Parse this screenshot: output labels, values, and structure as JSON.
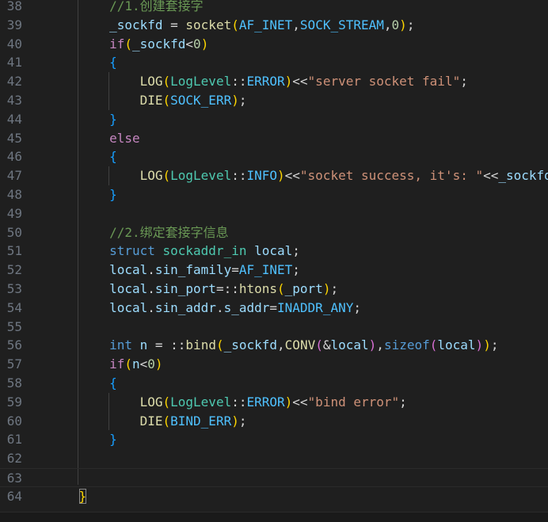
{
  "editor": {
    "lines": [
      {
        "n": "38",
        "tokens": [
          {
            "t": "        ",
            "c": "plain"
          },
          {
            "t": "//1.创建套接字",
            "c": "cmt"
          }
        ]
      },
      {
        "n": "39",
        "tokens": [
          {
            "t": "        ",
            "c": "plain"
          },
          {
            "t": "_sockfd",
            "c": "var"
          },
          {
            "t": " = ",
            "c": "op"
          },
          {
            "t": "socket",
            "c": "func"
          },
          {
            "t": "(",
            "c": "b1"
          },
          {
            "t": "AF_INET",
            "c": "const"
          },
          {
            "t": ",",
            "c": "op"
          },
          {
            "t": "SOCK_STREAM",
            "c": "const"
          },
          {
            "t": ",",
            "c": "op"
          },
          {
            "t": "0",
            "c": "num"
          },
          {
            "t": ")",
            "c": "b1"
          },
          {
            "t": ";",
            "c": "op"
          }
        ]
      },
      {
        "n": "40",
        "tokens": [
          {
            "t": "        ",
            "c": "plain"
          },
          {
            "t": "if",
            "c": "kw"
          },
          {
            "t": "(",
            "c": "b1"
          },
          {
            "t": "_sockfd",
            "c": "var"
          },
          {
            "t": "<",
            "c": "op"
          },
          {
            "t": "0",
            "c": "num"
          },
          {
            "t": ")",
            "c": "b1"
          }
        ]
      },
      {
        "n": "41",
        "tokens": [
          {
            "t": "        ",
            "c": "plain"
          },
          {
            "t": "{",
            "c": "b3"
          }
        ]
      },
      {
        "n": "42",
        "tokens": [
          {
            "t": "            ",
            "c": "plain"
          },
          {
            "t": "LOG",
            "c": "macro"
          },
          {
            "t": "(",
            "c": "b1"
          },
          {
            "t": "LogLevel",
            "c": "cls"
          },
          {
            "t": "::",
            "c": "op"
          },
          {
            "t": "ERROR",
            "c": "const"
          },
          {
            "t": ")",
            "c": "b1"
          },
          {
            "t": "<<",
            "c": "op"
          },
          {
            "t": "\"server socket fail\"",
            "c": "str"
          },
          {
            "t": ";",
            "c": "op"
          }
        ]
      },
      {
        "n": "43",
        "tokens": [
          {
            "t": "            ",
            "c": "plain"
          },
          {
            "t": "DIE",
            "c": "macro"
          },
          {
            "t": "(",
            "c": "b1"
          },
          {
            "t": "SOCK_ERR",
            "c": "const"
          },
          {
            "t": ")",
            "c": "b1"
          },
          {
            "t": ";",
            "c": "op"
          }
        ]
      },
      {
        "n": "44",
        "tokens": [
          {
            "t": "        ",
            "c": "plain"
          },
          {
            "t": "}",
            "c": "b3"
          }
        ]
      },
      {
        "n": "45",
        "tokens": [
          {
            "t": "        ",
            "c": "plain"
          },
          {
            "t": "else",
            "c": "kw"
          }
        ]
      },
      {
        "n": "46",
        "tokens": [
          {
            "t": "        ",
            "c": "plain"
          },
          {
            "t": "{",
            "c": "b3"
          }
        ]
      },
      {
        "n": "47",
        "tokens": [
          {
            "t": "            ",
            "c": "plain"
          },
          {
            "t": "LOG",
            "c": "macro"
          },
          {
            "t": "(",
            "c": "b1"
          },
          {
            "t": "LogLevel",
            "c": "cls"
          },
          {
            "t": "::",
            "c": "op"
          },
          {
            "t": "INFO",
            "c": "const"
          },
          {
            "t": ")",
            "c": "b1"
          },
          {
            "t": "<<",
            "c": "op"
          },
          {
            "t": "\"socket success, it's: \"",
            "c": "str"
          },
          {
            "t": "<<",
            "c": "op"
          },
          {
            "t": "_sockfd",
            "c": "var"
          }
        ]
      },
      {
        "n": "48",
        "tokens": [
          {
            "t": "        ",
            "c": "plain"
          },
          {
            "t": "}",
            "c": "b3"
          }
        ]
      },
      {
        "n": "49",
        "tokens": []
      },
      {
        "n": "50",
        "tokens": [
          {
            "t": "        ",
            "c": "plain"
          },
          {
            "t": "//2.绑定套接字信息",
            "c": "cmt"
          }
        ]
      },
      {
        "n": "51",
        "tokens": [
          {
            "t": "        ",
            "c": "plain"
          },
          {
            "t": "struct",
            "c": "type"
          },
          {
            "t": " ",
            "c": "plain"
          },
          {
            "t": "sockaddr_in",
            "c": "cls"
          },
          {
            "t": " ",
            "c": "plain"
          },
          {
            "t": "local",
            "c": "var"
          },
          {
            "t": ";",
            "c": "op"
          }
        ]
      },
      {
        "n": "52",
        "tokens": [
          {
            "t": "        ",
            "c": "plain"
          },
          {
            "t": "local",
            "c": "var"
          },
          {
            "t": ".",
            "c": "op"
          },
          {
            "t": "sin_family",
            "c": "var"
          },
          {
            "t": "=",
            "c": "op"
          },
          {
            "t": "AF_INET",
            "c": "const"
          },
          {
            "t": ";",
            "c": "op"
          }
        ]
      },
      {
        "n": "53",
        "tokens": [
          {
            "t": "        ",
            "c": "plain"
          },
          {
            "t": "local",
            "c": "var"
          },
          {
            "t": ".",
            "c": "op"
          },
          {
            "t": "sin_port",
            "c": "var"
          },
          {
            "t": "=::",
            "c": "op"
          },
          {
            "t": "htons",
            "c": "func"
          },
          {
            "t": "(",
            "c": "b1"
          },
          {
            "t": "_port",
            "c": "var"
          },
          {
            "t": ")",
            "c": "b1"
          },
          {
            "t": ";",
            "c": "op"
          }
        ]
      },
      {
        "n": "54",
        "tokens": [
          {
            "t": "        ",
            "c": "plain"
          },
          {
            "t": "local",
            "c": "var"
          },
          {
            "t": ".",
            "c": "op"
          },
          {
            "t": "sin_addr",
            "c": "var"
          },
          {
            "t": ".",
            "c": "op"
          },
          {
            "t": "s_addr",
            "c": "var"
          },
          {
            "t": "=",
            "c": "op"
          },
          {
            "t": "INADDR_ANY",
            "c": "const"
          },
          {
            "t": ";",
            "c": "op"
          }
        ]
      },
      {
        "n": "55",
        "tokens": []
      },
      {
        "n": "56",
        "tokens": [
          {
            "t": "        ",
            "c": "plain"
          },
          {
            "t": "int",
            "c": "type"
          },
          {
            "t": " ",
            "c": "plain"
          },
          {
            "t": "n",
            "c": "var"
          },
          {
            "t": " = ::",
            "c": "op"
          },
          {
            "t": "bind",
            "c": "func"
          },
          {
            "t": "(",
            "c": "b1"
          },
          {
            "t": "_sockfd",
            "c": "var"
          },
          {
            "t": ",",
            "c": "op"
          },
          {
            "t": "CONV",
            "c": "macro"
          },
          {
            "t": "(",
            "c": "b2"
          },
          {
            "t": "&",
            "c": "op"
          },
          {
            "t": "local",
            "c": "var"
          },
          {
            "t": ")",
            "c": "b2"
          },
          {
            "t": ",",
            "c": "op"
          },
          {
            "t": "sizeof",
            "c": "type"
          },
          {
            "t": "(",
            "c": "b2"
          },
          {
            "t": "local",
            "c": "var"
          },
          {
            "t": ")",
            "c": "b2"
          },
          {
            "t": ")",
            "c": "b1"
          },
          {
            "t": ";",
            "c": "op"
          }
        ]
      },
      {
        "n": "57",
        "tokens": [
          {
            "t": "        ",
            "c": "plain"
          },
          {
            "t": "if",
            "c": "kw"
          },
          {
            "t": "(",
            "c": "b1"
          },
          {
            "t": "n",
            "c": "var"
          },
          {
            "t": "<",
            "c": "op"
          },
          {
            "t": "0",
            "c": "num"
          },
          {
            "t": ")",
            "c": "b1"
          }
        ]
      },
      {
        "n": "58",
        "tokens": [
          {
            "t": "        ",
            "c": "plain"
          },
          {
            "t": "{",
            "c": "b3"
          }
        ]
      },
      {
        "n": "59",
        "tokens": [
          {
            "t": "            ",
            "c": "plain"
          },
          {
            "t": "LOG",
            "c": "macro"
          },
          {
            "t": "(",
            "c": "b1"
          },
          {
            "t": "LogLevel",
            "c": "cls"
          },
          {
            "t": "::",
            "c": "op"
          },
          {
            "t": "ERROR",
            "c": "const"
          },
          {
            "t": ")",
            "c": "b1"
          },
          {
            "t": "<<",
            "c": "op"
          },
          {
            "t": "\"bind error\"",
            "c": "str"
          },
          {
            "t": ";",
            "c": "op"
          }
        ]
      },
      {
        "n": "60",
        "tokens": [
          {
            "t": "            ",
            "c": "plain"
          },
          {
            "t": "DIE",
            "c": "macro"
          },
          {
            "t": "(",
            "c": "b1"
          },
          {
            "t": "BIND_ERR",
            "c": "const"
          },
          {
            "t": ")",
            "c": "b1"
          },
          {
            "t": ";",
            "c": "op"
          }
        ]
      },
      {
        "n": "61",
        "tokens": [
          {
            "t": "        ",
            "c": "plain"
          },
          {
            "t": "}",
            "c": "b3"
          }
        ]
      },
      {
        "n": "62",
        "tokens": []
      },
      {
        "n": "63",
        "tokens": [],
        "current": true
      },
      {
        "n": "64",
        "tokens": [
          {
            "t": "    ",
            "c": "plain"
          },
          {
            "t": "}",
            "c": "b1",
            "match": true
          }
        ]
      }
    ],
    "colors": {
      "background": "#1f1f1f",
      "line_number": "#6e7681",
      "comment": "#6a9955",
      "keyword": "#c586c0",
      "type_keyword": "#569cd6",
      "class_type": "#4ec9b0",
      "function": "#dcdcaa",
      "variable": "#9cdcfe",
      "constant": "#4fc1ff",
      "string": "#ce9178",
      "number": "#b5cea8",
      "bracket_1": "#ffd700",
      "bracket_2": "#da70d6",
      "bracket_3": "#179fff"
    }
  }
}
